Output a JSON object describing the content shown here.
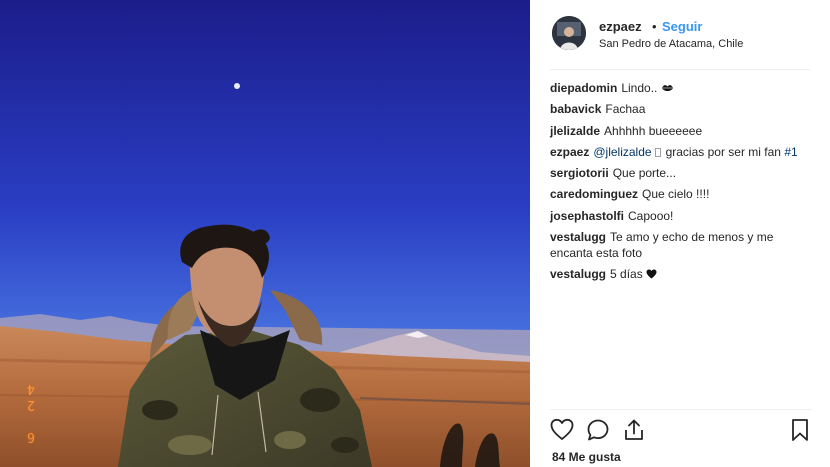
{
  "post": {
    "date_stamp": "6 24"
  },
  "header": {
    "username": "ezpaez",
    "separator": "•",
    "follow_label": "Seguir",
    "location": "San Pedro de Atacama, Chile"
  },
  "comments": [
    {
      "user": "diepadomin",
      "text": "Lindo..",
      "emoji": "kiss-lips-icon"
    },
    {
      "user": "babavick",
      "text": "Fachaa"
    },
    {
      "user": "jlelizalde",
      "text": "Ahhhhh bueeeeee"
    },
    {
      "user": "ezpaez",
      "mention": "@jlelizalde",
      "text": "gracias por ser mi fan",
      "tag": "#1"
    },
    {
      "user": "sergiotorii",
      "text": "Que porte..."
    },
    {
      "user": "caredominguez",
      "text": "Que cielo !!!!"
    },
    {
      "user": "josephastolfi",
      "text": "Capooo!"
    },
    {
      "user": "vestalugg",
      "text": "Te amo y echo de menos y me encanta esta foto"
    },
    {
      "user": "vestalugg",
      "text": "5 días",
      "emoji": "black-heart-icon"
    }
  ],
  "actions": {
    "like_icon": "heart-outline-icon",
    "comment_icon": "comment-bubble-icon",
    "share_icon": "share-upload-icon",
    "save_icon": "bookmark-icon"
  },
  "likes": {
    "label": "84 Me gusta"
  },
  "colors": {
    "link_blue": "#3897f0",
    "mention_blue": "#003569",
    "text": "#262626",
    "divider": "#efefef"
  }
}
